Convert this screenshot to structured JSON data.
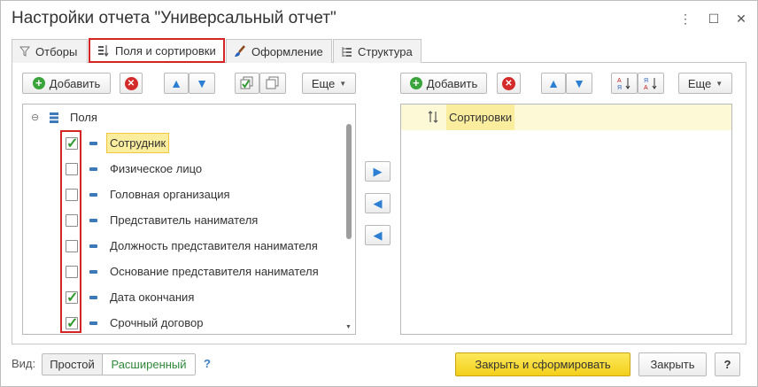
{
  "window": {
    "title": "Настройки отчета \"Универсальный отчет\"",
    "more_icon": "⋮",
    "maximize_icon": "☐",
    "close_icon": "✕"
  },
  "tabs": [
    {
      "label": "Отборы",
      "icon": "filter-icon"
    },
    {
      "label": "Поля и сортировки",
      "icon": "fields-sort-icon"
    },
    {
      "label": "Оформление",
      "icon": "brush-icon"
    },
    {
      "label": "Структура",
      "icon": "structure-icon"
    }
  ],
  "left_toolbar": {
    "add_label": "Добавить",
    "more_label": "Еще"
  },
  "right_toolbar": {
    "add_label": "Добавить",
    "more_label": "Еще"
  },
  "fields": {
    "root_label": "Поля",
    "items": [
      {
        "label": "Сотрудник",
        "checked": true,
        "selected": true
      },
      {
        "label": "Физическое лицо",
        "checked": false
      },
      {
        "label": "Головная организация",
        "checked": false
      },
      {
        "label": "Представитель нанимателя",
        "checked": false
      },
      {
        "label": "Должность представителя нанимателя",
        "checked": false
      },
      {
        "label": "Основание представителя нанимателя",
        "checked": false
      },
      {
        "label": "Дата окончания",
        "checked": true
      },
      {
        "label": "Срочный договор",
        "checked": true
      }
    ]
  },
  "sorting": {
    "root_label": "Сортировки"
  },
  "footer": {
    "view_label": "Вид:",
    "simple_label": "Простой",
    "extended_label": "Расширенный",
    "help_label": "?",
    "close_generate_label": "Закрыть и сформировать",
    "close_label": "Закрыть",
    "question_label": "?"
  },
  "colors": {
    "accent_yellow": "#f5d230",
    "highlight_red": "#d62424",
    "check_green": "#2f9b2f"
  }
}
